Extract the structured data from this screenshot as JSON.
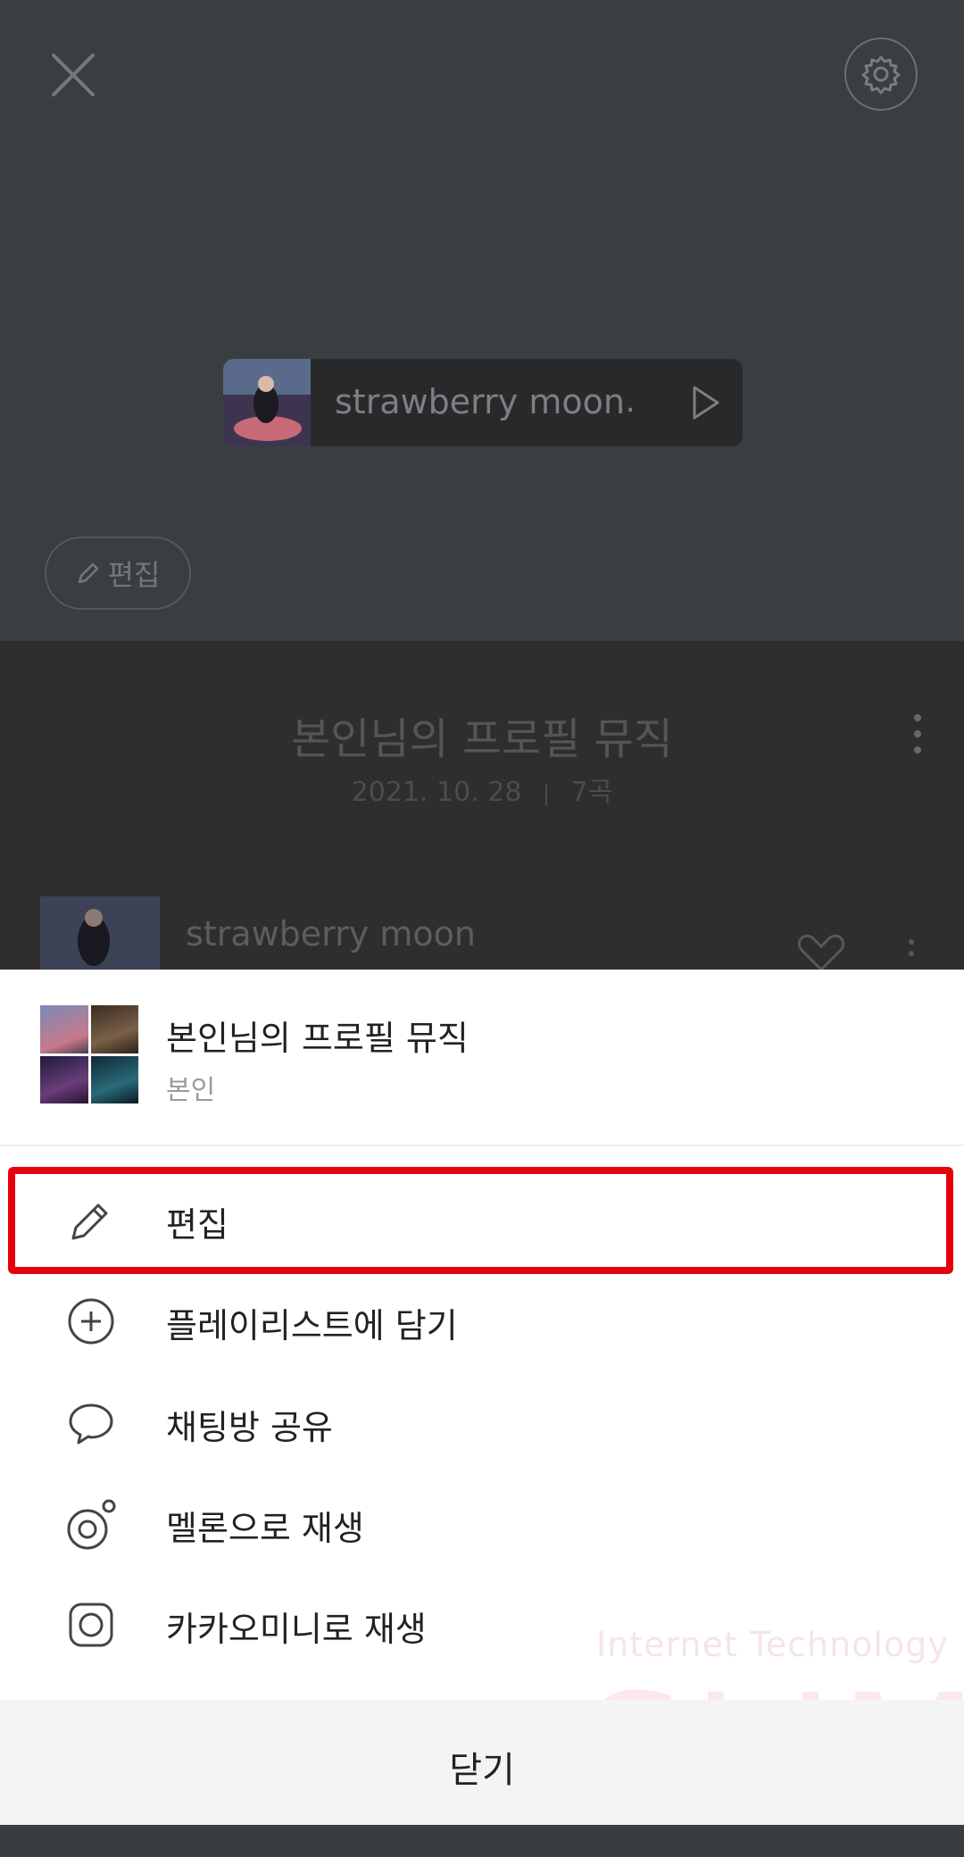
{
  "now_playing": {
    "title": "strawberry moon",
    "ellipsis": ".."
  },
  "profile": {
    "edit_label": "편집"
  },
  "playlist": {
    "title": "본인님의 프로필 뮤직",
    "date": "2021. 10. 28",
    "separator": "|",
    "count": "7곡",
    "first_song": "strawberry moon"
  },
  "sheet": {
    "title": "본인님의 프로필 뮤직",
    "owner": "본인",
    "menu": [
      {
        "label": "편집",
        "icon": "pencil-icon"
      },
      {
        "label": "플레이리스트에 담기",
        "icon": "plus-circle-icon"
      },
      {
        "label": "채팅방 공유",
        "icon": "chat-bubble-icon"
      },
      {
        "label": "멜론으로 재생",
        "icon": "melon-icon"
      },
      {
        "label": "카카오미니로 재생",
        "icon": "kakao-mini-icon"
      }
    ],
    "close_label": "닫기"
  },
  "watermark": {
    "line1": "Internet Technology",
    "line2": "SLIM"
  },
  "colors": {
    "highlight": "#e8000b",
    "sheet_bg": "#ffffff",
    "dim_top": "#3b3e41",
    "dim_mid": "#2f2d2e"
  }
}
